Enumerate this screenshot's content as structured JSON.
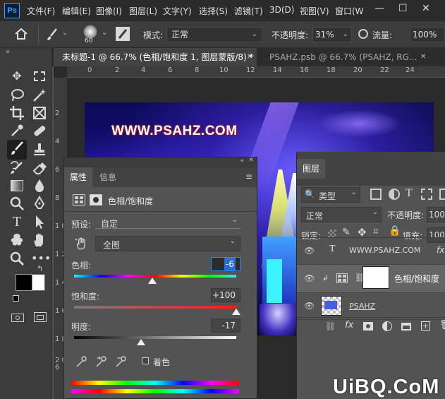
{
  "app": {
    "logo": "Ps"
  },
  "menu": [
    "文件(F)",
    "编辑(E)",
    "图像(I)",
    "图层(L)",
    "文字(Y)",
    "选择(S)",
    "滤镜(T)",
    "3D(D)",
    "视图(V)",
    "窗口(W"
  ],
  "window_controls": {
    "minimize": "—",
    "maximize": "☐",
    "close": "✕"
  },
  "options_bar": {
    "brush_size": "60",
    "mode_label": "模式:",
    "mode_value": "正常",
    "opacity_label": "不透明度:",
    "opacity_value": "31%",
    "flow_label": "流量:",
    "flow_value": "100%"
  },
  "tabs": [
    {
      "label": "未标题-1 @ 66.7% (色相/饱和度 1, 图层蒙版/8) *",
      "close": "✕"
    },
    {
      "label": "PSAHZ.psb @ 66.7% (PSAHZ, RG...",
      "close": "✕"
    }
  ],
  "ruler_h": [
    "0",
    "2",
    "4",
    "6",
    "8",
    "10",
    "12",
    "14",
    "16",
    "18",
    "20",
    "22",
    "24"
  ],
  "ruler_v": [
    "2",
    "4",
    "6",
    "8",
    "1 0",
    "1 2",
    "1 4",
    "1 6",
    "1 8",
    "2 0",
    "6"
  ],
  "canvas": {
    "text": "WWW.PSAHZ.COM"
  },
  "properties": {
    "tab_active": "属性",
    "tab_inactive": "信息",
    "adjustment_title": "色相/饱和度",
    "preset_label": "预设:",
    "preset_value": "自定",
    "range_value": "全图",
    "hue_label": "色相:",
    "hue_value": "-6",
    "hue_fraction": 0.483,
    "saturation_label": "饱和度:",
    "saturation_value": "+100",
    "saturation_fraction": 1.0,
    "lightness_label": "明度:",
    "lightness_value": "-17",
    "lightness_fraction": 0.415,
    "colorize_label": "着色"
  },
  "layers": {
    "title": "图层",
    "filter_value": "类型",
    "blend_value": "正常",
    "opacity_label": "不透明度:",
    "opacity_value": "100",
    "lock_label": "锁定:",
    "fill_label": "填充:",
    "fill_value": "100",
    "rows": [
      {
        "name": "WWW.PSAHZ.COM",
        "type_icon": "T",
        "fx": "fx"
      },
      {
        "name": "色相/饱和度"
      },
      {
        "name": "PSAHZ"
      }
    ]
  },
  "watermark": "UiBQ.CoM"
}
